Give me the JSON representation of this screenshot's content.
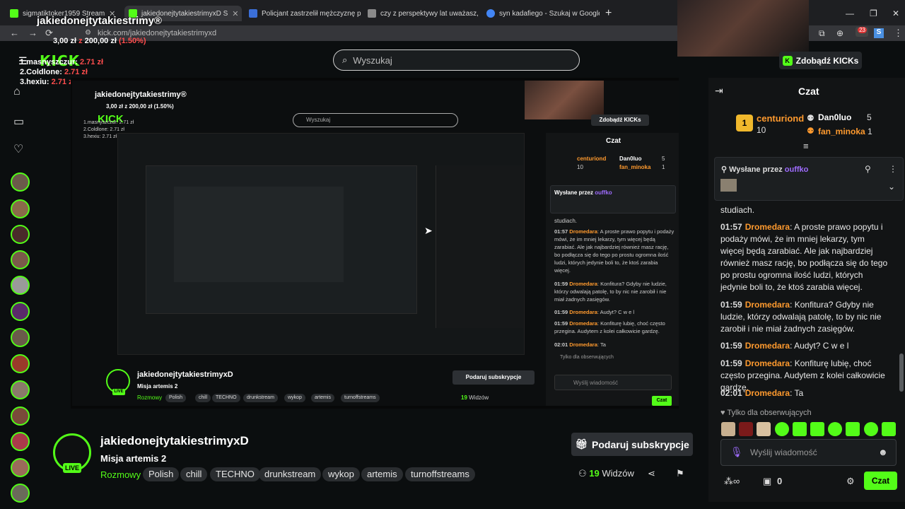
{
  "browser": {
    "tabs": [
      {
        "label": "sigmatiktoker1959 Stream",
        "color": "#53fc18"
      },
      {
        "label": "jakiedonejtytakiestrimyxD S",
        "color": "#53fc18"
      },
      {
        "label": "Policjant zastrzelił mężczyznę p",
        "color": "#3b6fd8"
      },
      {
        "label": "czy z perspektywy lat uważasz, ż",
        "color": "#3b6fd8"
      },
      {
        "label": "syn kadafiego - Szukaj w Google",
        "color": "#4285f4"
      }
    ],
    "new_tab": "+",
    "url": "kick.com/jakiedonejtytakiestrimyxd",
    "ext_badge": "23"
  },
  "overlay": {
    "title": "jakiedonejtytakiestrimy®",
    "goal_prefix": "3,00 zł",
    "goal_sep": " z ",
    "goal_target": "200,00 zł",
    "goal_pct": "(1.50%)",
    "kick_logo": "KICK",
    "ranks": [
      {
        "label": "1.masnyszczur:",
        "amount": "2.71 zł"
      },
      {
        "label": "2.Coldlone:",
        "amount": "2.71 zł"
      },
      {
        "label": "3.hexiu:",
        "amount": "2.71 zł"
      }
    ]
  },
  "header": {
    "search_placeholder": "Wyszukaj",
    "get_kicks": "Zdobądź KICKs"
  },
  "stream_mirror": {
    "title": "jakiedonejtytakiestrimy®",
    "goal": "3,00 zł z 200,00 zł (1.50%)",
    "search": "Wyszukaj",
    "get_kicks": "Zdobądź KICKs",
    "chat_title": "Czat",
    "leaders": [
      {
        "name": "centuriond",
        "num": "10"
      },
      {
        "name": "Dan0luo",
        "num": "5"
      },
      {
        "name": "fan_minoka",
        "num": "1"
      }
    ],
    "pinned_by": "Wysłane przez",
    "pinned_user": "ouffko",
    "msgs": [
      {
        "time": "",
        "user": "",
        "text": "studiach."
      },
      {
        "time": "01:57",
        "user": "Dromedara",
        "text": "A proste prawo popytu i podaży mówi, że im mniej lekarzy, tym więcej będą zarabiać. Ale jak najbardziej również masz rację, bo podłącza się do tego po prostu ogromna ilość ludzi, których jedynie boli to, że ktoś zarabia więcej."
      },
      {
        "time": "01:59",
        "user": "Dromedara",
        "text": "Konfitura? Gdyby nie ludzie, którzy odwalają patolę, to by nic nie zarobił i nie miał żadnych zasięgów."
      },
      {
        "time": "01:59",
        "user": "Dromedara",
        "text": "Audyt? C w e l"
      },
      {
        "time": "01:59",
        "user": "Dromedara",
        "text": "Konfiturę lubię, choć często przegina. Audytem z kolei całkowicie gardzę."
      },
      {
        "time": "02:01",
        "user": "Dromedara",
        "text": "Ta"
      }
    ],
    "followers_only": "Tylko dla obserwujących",
    "chat_placeholder": "Wyślij wiadomość",
    "chat_send": "Czat",
    "chan_name": "jakiedonejtytakiestrimyxD",
    "chan_title": "Misja artemis 2",
    "category": "Rozmowy",
    "tags": [
      "Polish",
      "chill",
      "TECHNO",
      "drunkstream",
      "wykop",
      "artemis",
      "turnoffstreams"
    ],
    "viewers": "19",
    "viewers_label": "Widzów",
    "sub_btn": "Podaruj subskrypcje",
    "live": "LIVE",
    "kick_logo": "KICK",
    "ranks": [
      "1.masnyszczur: 2.71 zł",
      "2.Coldlone: 2.71 zł",
      "3.hexiu: 2.71 zł"
    ]
  },
  "channel": {
    "name": "jakiedonejtytakiestrimyxD",
    "title": "Misja artemis 2",
    "category": "Rozmowy",
    "tags": [
      "Polish",
      "chill",
      "TECHNO",
      "drunkstream",
      "wykop",
      "artemis",
      "turnoffstreams"
    ],
    "live": "LIVE",
    "subscribe_btn": "Podaruj subskrypcje",
    "viewers": "19",
    "viewers_label": "Widzów"
  },
  "chat": {
    "title": "Czat",
    "leaders": [
      {
        "name": "centuriond",
        "num": "10",
        "color": "#ff9a2e"
      },
      {
        "name": "Dan0luo",
        "num": "5",
        "color": "#ffffff"
      },
      {
        "name": "fan_minoka",
        "num": "1",
        "color": "#ff9a2e"
      }
    ],
    "pinned_by": "Wysłane przez",
    "pinned_user": "ouffko",
    "messages": [
      {
        "time": "",
        "user": "",
        "text": "studiach."
      },
      {
        "time": "01:57",
        "user": "Dromedara",
        "text": "A proste prawo popytu i podaży mówi, że im mniej lekarzy, tym więcej będą zarabiać. Ale jak najbardziej również masz rację, bo podłącza się do tego po prostu ogromna ilość ludzi, których jedynie boli to, że ktoś zarabia więcej."
      },
      {
        "time": "01:59",
        "user": "Dromedara",
        "text": "Konfitura? Gdyby nie ludzie, którzy odwalają patolę, to by nic nie zarobił i nie miał żadnych zasięgów."
      },
      {
        "time": "01:59",
        "user": "Dromedara",
        "text": "Audyt? C w e l"
      },
      {
        "time": "01:59",
        "user": "Dromedara",
        "text": "Konfiturę lubię, choć często przegina. Audytem z kolei całkowicie gardzę."
      },
      {
        "time": "02:01",
        "user": "Dromedara",
        "text": "Ta"
      }
    ],
    "followers_only": "Tylko dla obserwujących",
    "input_placeholder": "Wyślij wiadomość",
    "send": "Czat",
    "kicks_count": "0"
  },
  "colors": {
    "accent": "#53fc18",
    "username": "#ff9a2e",
    "pinned_user": "#9f6cff"
  }
}
